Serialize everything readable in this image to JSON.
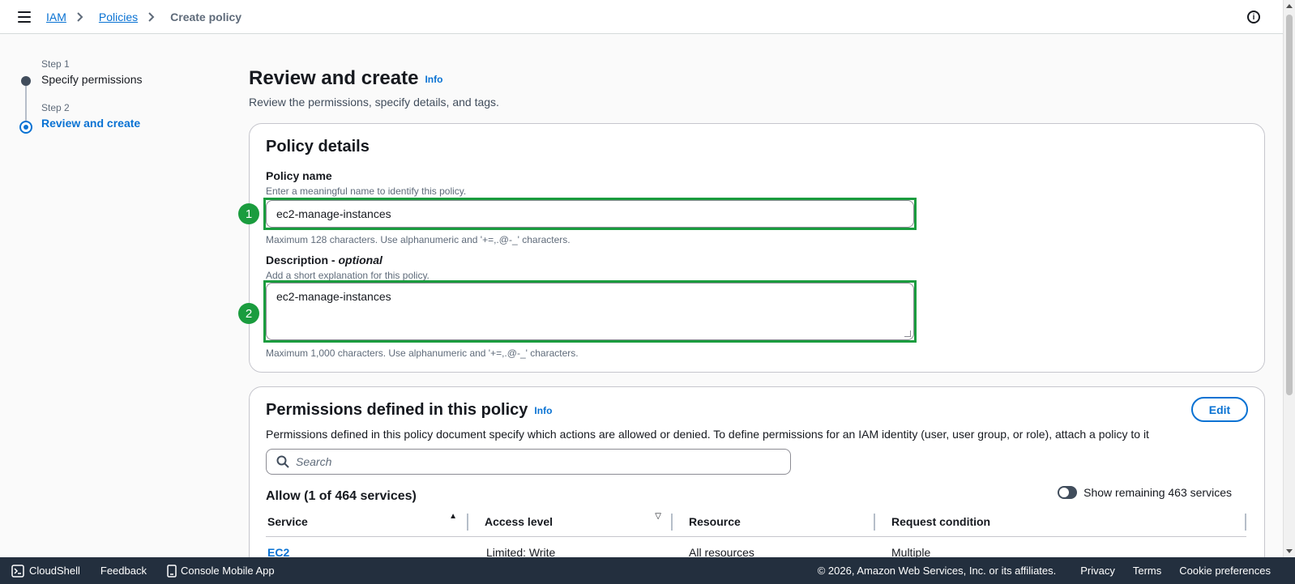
{
  "breadcrumb": {
    "items": [
      "IAM",
      "Policies"
    ],
    "current": "Create policy"
  },
  "steps": [
    {
      "label": "Step 1",
      "title": "Specify permissions"
    },
    {
      "label": "Step 2",
      "title": "Review and create"
    }
  ],
  "page": {
    "title": "Review and create",
    "info": "Info",
    "subtitle": "Review the permissions, specify details, and tags."
  },
  "policy_details": {
    "heading": "Policy details",
    "name_label": "Policy name",
    "name_desc": "Enter a meaningful name to identify this policy.",
    "name_value": "ec2-manage-instances",
    "name_constraint": "Maximum 128 characters. Use alphanumeric and '+=,.@-_' characters.",
    "desc_label": "Description - ",
    "desc_optional": "optional",
    "desc_desc": "Add a short explanation for this policy.",
    "desc_value": "ec2-manage-instances",
    "desc_constraint": "Maximum 1,000 characters. Use alphanumeric and '+=,.@-_' characters.",
    "badge1": "1",
    "badge2": "2"
  },
  "permissions": {
    "heading": "Permissions defined in this policy",
    "info": "Info",
    "edit_label": "Edit",
    "description": "Permissions defined in this policy document specify which actions are allowed or denied. To define permissions for an IAM identity (user, user group, or role), attach a policy to it",
    "search_placeholder": "Search",
    "allow_title": "Allow (1 of 464 services)",
    "toggle_label": "Show remaining 463 services",
    "columns": [
      "Service",
      "Access level",
      "Resource",
      "Request condition"
    ],
    "rows": [
      {
        "service": "EC2",
        "access": "Limited: Write",
        "resource": "All resources",
        "condition": "Multiple"
      }
    ]
  },
  "footer": {
    "cloudshell": "CloudShell",
    "feedback": "Feedback",
    "mobile_app": "Console Mobile App",
    "copyright": "© 2026, Amazon Web Services, Inc. or its affiliates.",
    "privacy": "Privacy",
    "terms": "Terms",
    "cookies": "Cookie preferences"
  },
  "colors": {
    "accent": "#0972d3",
    "highlight": "#1a9c3e",
    "footer_bg": "#232f3e"
  }
}
